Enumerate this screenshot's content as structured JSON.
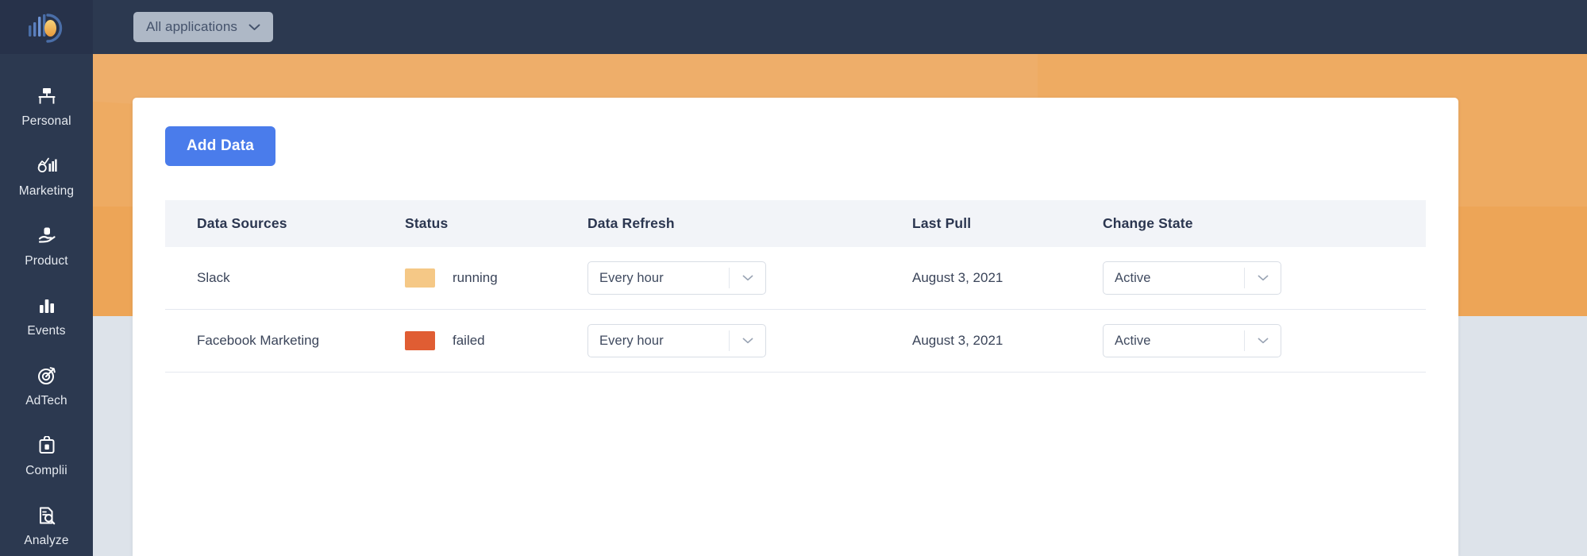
{
  "brand": {
    "logo_name": "brand-logo",
    "colors": {
      "navy": "#2c3950",
      "orange": "#eda557",
      "accent_blue": "#4a7ceb",
      "page_bg": "#dde3ea"
    }
  },
  "topbar": {
    "app_filter": {
      "label": "All applications",
      "icon": "chevron-down-icon"
    }
  },
  "sidebar": {
    "items": [
      {
        "label": "Personal",
        "icon": "desk-icon"
      },
      {
        "label": "Marketing",
        "icon": "marketing-chart-icon"
      },
      {
        "label": "Product",
        "icon": "product-hand-icon"
      },
      {
        "label": "Events",
        "icon": "bar-chart-icon"
      },
      {
        "label": "AdTech",
        "icon": "target-icon"
      },
      {
        "label": "Complii",
        "icon": "lock-briefcase-icon"
      },
      {
        "label": "Analyze",
        "icon": "document-search-icon"
      }
    ]
  },
  "main": {
    "add_data_button": "Add Data",
    "table": {
      "columns": [
        "Data Sources",
        "Status",
        "Data Refresh",
        "Last Pull",
        "Change State"
      ],
      "rows": [
        {
          "source": "Slack",
          "status": {
            "text": "running",
            "color": "#f5c886"
          },
          "refresh": {
            "value": "Every hour",
            "icon": "chevron-down-icon"
          },
          "last_pull": "August 3, 2021",
          "state": {
            "value": "Active",
            "icon": "chevron-down-icon"
          }
        },
        {
          "source": "Facebook Marketing",
          "status": {
            "text": "failed",
            "color": "#e05d33"
          },
          "refresh": {
            "value": "Every hour",
            "icon": "chevron-down-icon"
          },
          "last_pull": "August 3, 2021",
          "state": {
            "value": "Active",
            "icon": "chevron-down-icon"
          }
        }
      ]
    }
  }
}
